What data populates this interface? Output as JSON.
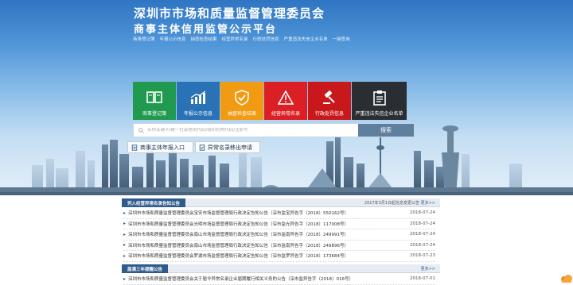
{
  "header": {
    "title_line1": "深圳市市场和质量监督管理委员会",
    "title_line2": "商事主体信用监管公示平台",
    "nav_links": [
      "商事登记簿",
      "年报公示信息",
      "抽查检查结果",
      "经营异常名录",
      "行政处罚信息",
      "严重违法失信企业名单",
      "一键查询"
    ]
  },
  "tiles": [
    {
      "label": "商事登记簿",
      "color": "#1f9a4f",
      "icon": "book-icon"
    },
    {
      "label": "年报公示信息",
      "color": "#2a72b6",
      "icon": "chart-icon"
    },
    {
      "label": "抽查检查结果",
      "color": "#f29a12",
      "icon": "shield-check-icon"
    },
    {
      "label": "经营异常名录",
      "color": "#db1f24",
      "icon": "warning-icon"
    },
    {
      "label": "行政处罚信息",
      "color": "#c9181c",
      "icon": "gavel-icon"
    },
    {
      "label": "严重违法失信企业名单",
      "color": "#2a2e33",
      "icon": "clipboard-icon"
    }
  ],
  "search": {
    "placeholder": "名称关键字/统一社会信用代码/组织机构代码/注册号",
    "button_label": "搜索"
  },
  "quick_links": [
    {
      "label": "商事主体年报入口"
    },
    {
      "label": "异常名录移出申请"
    }
  ],
  "panel1": {
    "tab": "列入经营异常名录告知公告",
    "note": "2017年3月1日起信息变更公告",
    "more": "更多>>",
    "rows": [
      {
        "text": "深圳市市场和质量监督管理委员会宝安市场监督管理局行政决定告知公告（深市监宝异告字〔2018〕550162号）",
        "date": "2018-07-24"
      },
      {
        "text": "深圳市市场和质量监督管理委员会光明市场监督管理局行政决定告知公告（深市监光异告字〔2018〕117008号）",
        "date": "2018-07-24"
      },
      {
        "text": "深圳市市场和质量监督管理委员会南山市场监督管理局行政决定告知公告（深市监南异告字〔2018〕249991号）",
        "date": "2018-07-24"
      },
      {
        "text": "深圳市市场和质量监督管理委员会南山市场监督管理局行政决定告知公告（深市监南异告字〔2018〕249896号）",
        "date": "2018-07-24"
      },
      {
        "text": "深圳市市场和质量监督管理委员会罗湖市场监督管理局行政决定告知公告（深市监罗异告字〔2018〕173684号）",
        "date": "2018-07-23"
      }
    ]
  },
  "panel2": {
    "tab": "届满三年提醒公告",
    "more": "更多>>",
    "rows": [
      {
        "text": "深圳市市场和质量监督管理委员会关于届令异常名录企业届期履行相关义务的公告（深市监异告字〔2018〕016号）",
        "date": "2018-07-01"
      }
    ]
  }
}
